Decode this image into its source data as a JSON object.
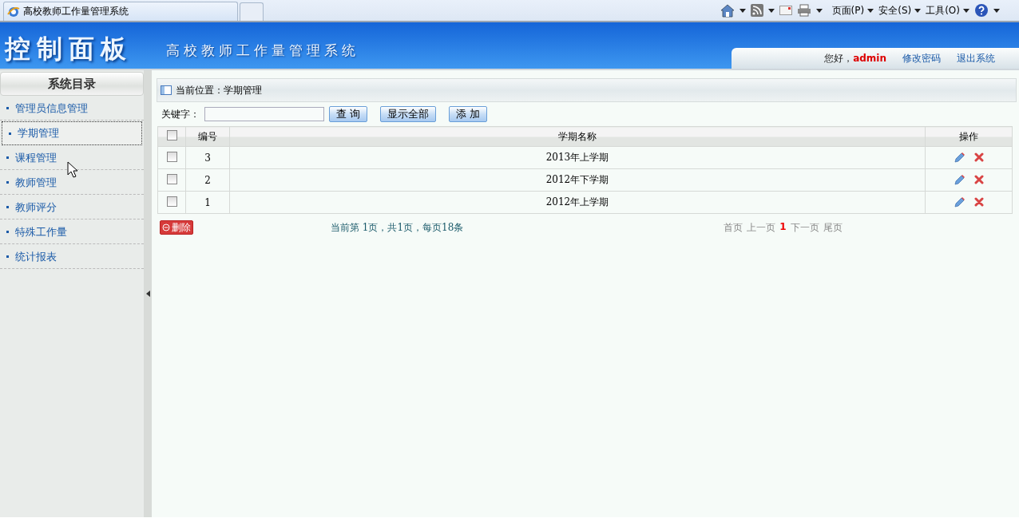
{
  "browser": {
    "tab_title": "高校教师工作量管理系统",
    "menus": [
      "页面(P)",
      "安全(S)",
      "工具(O)"
    ]
  },
  "header": {
    "logo": "控制面板",
    "subtitle": "高校教师工作量管理系统",
    "greeting": "您好，",
    "user": "admin",
    "links": [
      "修改密码",
      "退出系统"
    ]
  },
  "sidebar": {
    "title": "系统目录",
    "items": [
      {
        "label": "管理员信息管理",
        "selected": false
      },
      {
        "label": "学期管理",
        "selected": true
      },
      {
        "label": "课程管理",
        "selected": false
      },
      {
        "label": "教师管理",
        "selected": false
      },
      {
        "label": "教师评分",
        "selected": false
      },
      {
        "label": "特殊工作量",
        "selected": false
      },
      {
        "label": "统计报表",
        "selected": false
      }
    ]
  },
  "breadcrumb": "当前位置：学期管理",
  "search": {
    "label": "关键字：",
    "buttons": [
      "查 询",
      "显示全部",
      "添 加"
    ]
  },
  "table": {
    "columns": [
      "编号",
      "学期名称",
      "操作"
    ],
    "all_checked": false,
    "rows": [
      {
        "id": "3",
        "name": "2013年上学期",
        "checked": false
      },
      {
        "id": "2",
        "name": "2012年下学期",
        "checked": false
      },
      {
        "id": "1",
        "name": "2012年上学期",
        "checked": false
      }
    ]
  },
  "delete_button": "删除",
  "page_info": "当前第 1页，共1页，每页18条",
  "pager": [
    {
      "label": "首页",
      "selected": false
    },
    {
      "label": "上一页",
      "selected": false
    },
    {
      "label": "1",
      "selected": true
    },
    {
      "label": "下一页",
      "selected": false
    },
    {
      "label": "尾页",
      "selected": false
    }
  ]
}
